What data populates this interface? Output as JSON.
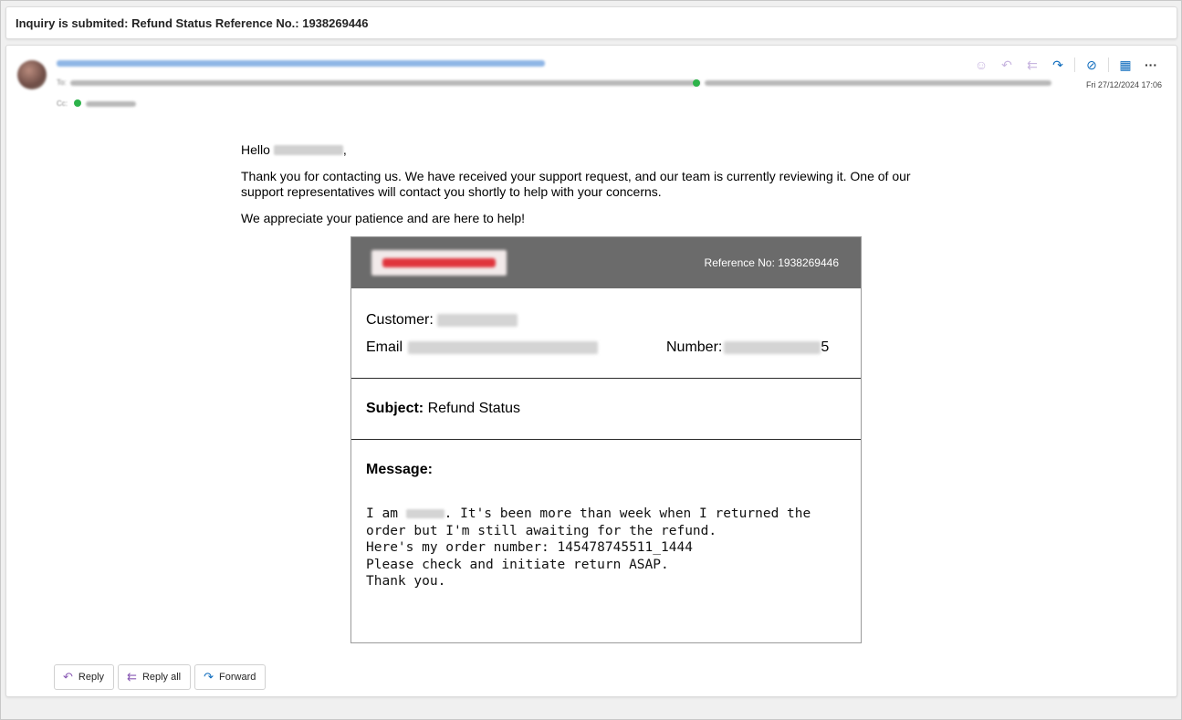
{
  "subject_bar": {
    "title": "Inquiry is submited: Refund Status Reference No.: 1938269446"
  },
  "header": {
    "to_prefix": "To:",
    "cc_label": "Cc:",
    "date": "Fri 27/12/2024 17:06",
    "action_icons": [
      "emoji-icon",
      "reply-icon",
      "reply-all-icon",
      "forward-icon",
      "loop-icon",
      "apps-icon",
      "more-icon"
    ],
    "more_label": "···"
  },
  "body": {
    "greeting": "Hello",
    "greeting_suffix": ",",
    "paragraph1": "Thank you for contacting us. We have received your support request, and our team is currently reviewing it. One of our support representatives will contact you shortly to help with your concerns.",
    "paragraph2": "We appreciate your patience and are here to help!"
  },
  "ticket": {
    "reference": "Reference No: 1938269446",
    "customer_label": "Customer:",
    "email_label": "Email",
    "number_label": "Number:",
    "number_tail": "5",
    "subject_label": "Subject:",
    "subject_value": "Refund Status",
    "message_label": "Message:",
    "message_line1_pre": "I am ",
    "message_line1_post": ". It's been more than week when I returned the",
    "message_line2": "order but I'm still awaiting for the refund.",
    "message_line3": "Here's my order number: 145478745511_1444",
    "message_line4": "Please check and initiate return ASAP.",
    "message_line5": "Thank you."
  },
  "buttons": {
    "reply": "Reply",
    "reply_all": "Reply all",
    "forward": "Forward"
  },
  "colors": {
    "header_gray": "#6b6b6b",
    "link_blue": "#0f6cbd",
    "reply_purple": "#8a5bb5",
    "presence_green": "#2db34a"
  }
}
